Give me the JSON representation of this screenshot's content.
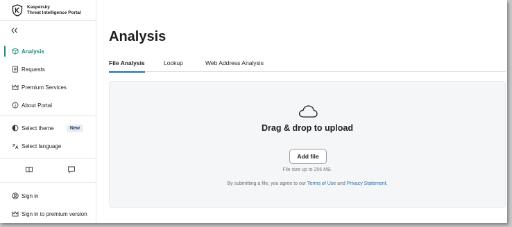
{
  "app": {
    "brand_line1": "Kaspersky",
    "brand_line2": "Threat Intelligence Portal",
    "accent_color": "#1b8c7d",
    "link_color": "#1d6bb5"
  },
  "sidebar": {
    "collapse_icon": "double-chevron-left-icon",
    "items": [
      {
        "label": "Analysis",
        "icon": "cube-icon",
        "active": true
      },
      {
        "label": "Requests",
        "icon": "document-icon"
      },
      {
        "label": "Premium Services",
        "icon": "crown-icon"
      },
      {
        "label": "About Portal",
        "icon": "info-icon"
      },
      {
        "label": "Select theme",
        "icon": "theme-icon",
        "badge": "New"
      },
      {
        "label": "Select language",
        "icon": "language-icon"
      },
      {
        "label": "Sign in",
        "icon": "user-icon"
      },
      {
        "label": "Sign in to premium version",
        "icon": "crown-icon"
      }
    ],
    "bottom_icons": [
      "book-icon",
      "chat-icon"
    ]
  },
  "main": {
    "title": "Analysis",
    "tabs": [
      {
        "label": "File Analysis",
        "active": true
      },
      {
        "label": "Lookup"
      },
      {
        "label": "Web Address Analysis"
      }
    ],
    "upload": {
      "icon": "cloud-icon",
      "title": "Drag & drop to upload",
      "button_label": "Add file",
      "size_note": "File size up to 256 MB.",
      "agree_prefix": "By submitting a file, you agree to our",
      "terms_link": "Terms of Use",
      "agree_and": "and",
      "privacy_link": "Privacy Statement",
      "agree_suffix": "."
    }
  }
}
